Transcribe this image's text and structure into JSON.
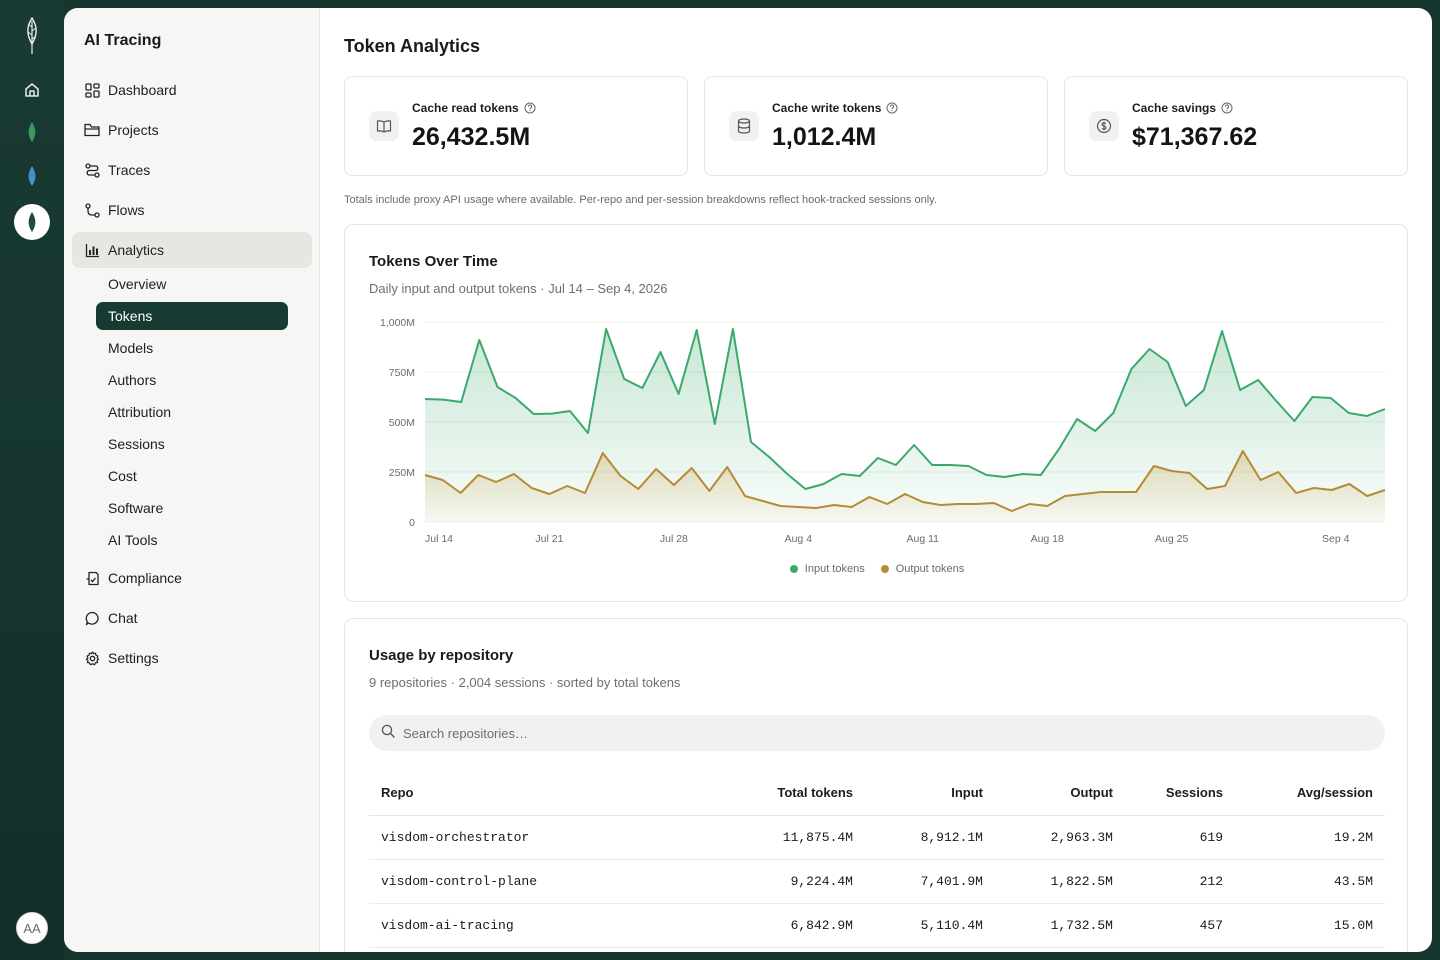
{
  "app": {
    "title": "AI Tracing",
    "avatar_initials": "AA"
  },
  "rail": {
    "icons": [
      "logo-icon",
      "home-icon",
      "green-drop-icon",
      "blue-drop-icon",
      "drop-active-icon"
    ]
  },
  "sidebar": {
    "items": [
      {
        "label": "Dashboard",
        "icon": "dashboard-icon"
      },
      {
        "label": "Projects",
        "icon": "folder-icon"
      },
      {
        "label": "Traces",
        "icon": "traces-icon"
      },
      {
        "label": "Flows",
        "icon": "flows-icon"
      },
      {
        "label": "Analytics",
        "icon": "analytics-icon"
      },
      {
        "label": "Compliance",
        "icon": "compliance-icon"
      },
      {
        "label": "Chat",
        "icon": "chat-icon"
      },
      {
        "label": "Settings",
        "icon": "settings-icon"
      }
    ],
    "analytics_sub": [
      "Overview",
      "Tokens",
      "Models",
      "Authors",
      "Attribution",
      "Sessions",
      "Cost",
      "Software",
      "AI Tools"
    ],
    "selected_sub": "Tokens"
  },
  "page": {
    "title": "Token Analytics",
    "note": "Totals include proxy API usage where available. Per-repo and per-session breakdowns reflect hook-tracked sessions only."
  },
  "stats": [
    {
      "label": "Cache read tokens",
      "value": "26,432.5M",
      "icon": "book-icon"
    },
    {
      "label": "Cache write tokens",
      "value": "1,012.4M",
      "icon": "database-icon"
    },
    {
      "label": "Cache savings",
      "value": "$71,367.62",
      "icon": "dollar-icon"
    }
  ],
  "chart_panel": {
    "title": "Tokens Over Time",
    "subtitle": "Daily input and output tokens · Jul 14 – Sep 4, 2026"
  },
  "chart_data": {
    "type": "area",
    "title": "Tokens Over Time",
    "y_ticks": [
      "1,000M",
      "750M",
      "500M",
      "250M",
      "0"
    ],
    "y_tick_values": [
      1000,
      750,
      500,
      250,
      0
    ],
    "ylim": [
      0,
      1000
    ],
    "x_ticks": [
      "Jul 14",
      "Jul 21",
      "Jul 28",
      "Aug 4",
      "Aug 11",
      "Aug 18",
      "Aug 25",
      "Sep 4"
    ],
    "x_tick_days": [
      0,
      7,
      14,
      21,
      28,
      35,
      42,
      52
    ],
    "grid": true,
    "legend": "bottom-center",
    "series": [
      {
        "name": "Input tokens",
        "color": "#3aa96a",
        "values": [
          615,
          612,
          600,
          910,
          675,
          620,
          540,
          542,
          555,
          445,
          965,
          715,
          670,
          850,
          640,
          960,
          490,
          965,
          400,
          325,
          240,
          165,
          190,
          240,
          230,
          320,
          285,
          385,
          285,
          285,
          280,
          235,
          225,
          240,
          235,
          365,
          515,
          455,
          545,
          765,
          865,
          800,
          580,
          660,
          955,
          660,
          710,
          605,
          505,
          625,
          620,
          545,
          530,
          565
        ]
      },
      {
        "name": "Output tokens",
        "color": "#b58b35",
        "values": [
          235,
          210,
          145,
          235,
          200,
          240,
          170,
          140,
          180,
          145,
          345,
          230,
          165,
          265,
          185,
          270,
          155,
          275,
          130,
          105,
          80,
          75,
          70,
          85,
          75,
          125,
          90,
          140,
          100,
          85,
          90,
          90,
          95,
          55,
          90,
          80,
          130,
          140,
          150,
          150,
          150,
          280,
          255,
          245,
          165,
          180,
          355,
          210,
          250,
          145,
          170,
          160,
          190,
          130,
          160
        ]
      }
    ]
  },
  "repo_panel": {
    "title": "Usage by repository",
    "subtitle": "9 repositories · 2,004 sessions · sorted by total tokens",
    "search_placeholder": "Search repositories…",
    "columns": [
      "Repo",
      "Total tokens",
      "Input",
      "Output",
      "Sessions",
      "Avg/session"
    ],
    "rows": [
      [
        "visdom-orchestrator",
        "11,875.4M",
        "8,912.1M",
        "2,963.3M",
        "619",
        "19.2M"
      ],
      [
        "visdom-control-plane",
        "9,224.4M",
        "7,401.9M",
        "1,822.5M",
        "212",
        "43.5M"
      ],
      [
        "visdom-ai-tracing",
        "6,842.9M",
        "5,110.4M",
        "1,732.5M",
        "457",
        "15.0M"
      ]
    ]
  }
}
